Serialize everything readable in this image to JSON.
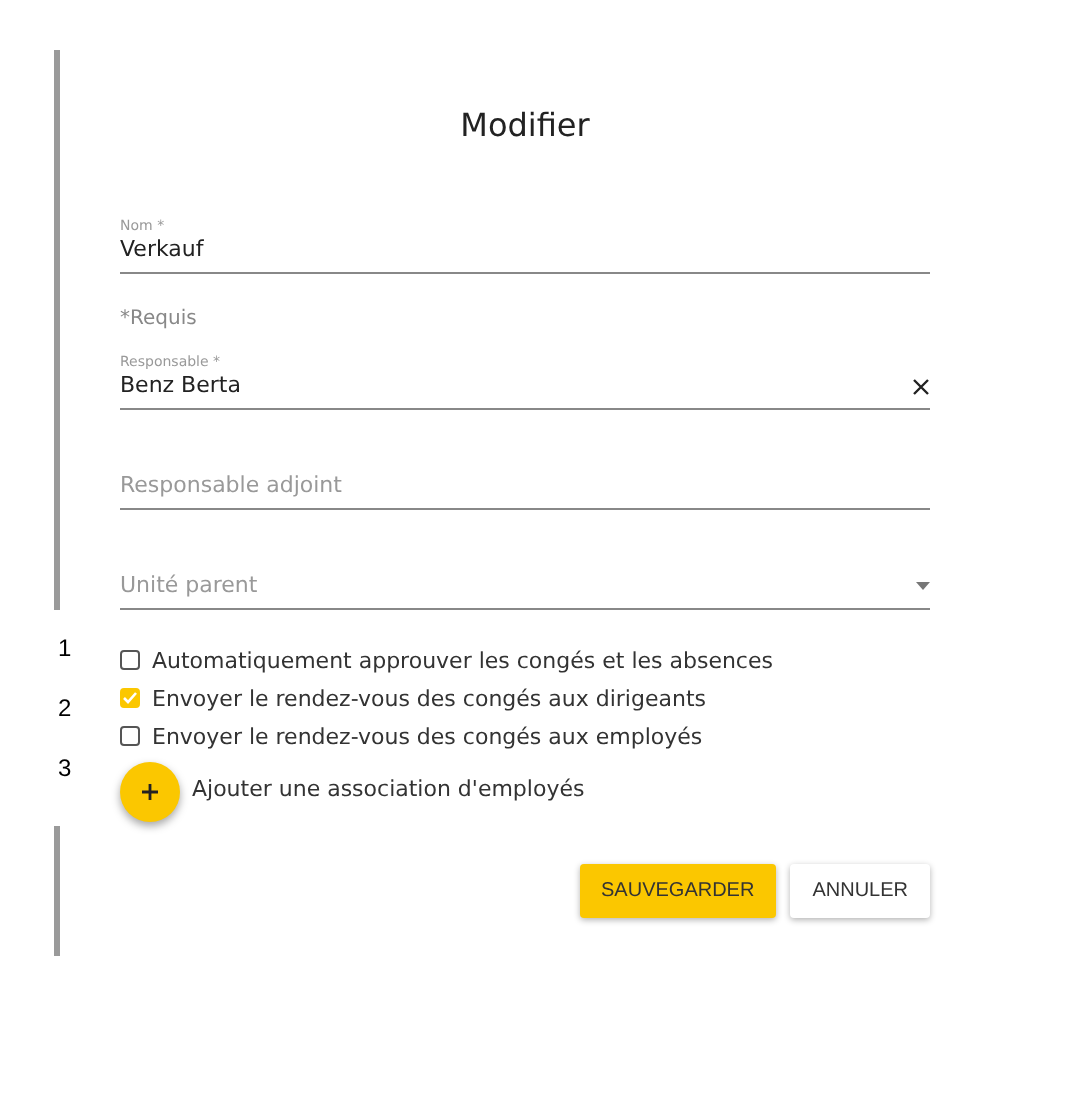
{
  "title": "Modifier",
  "fields": [
    {
      "kind": "text",
      "label": "Nom *",
      "value": "Verkauf"
    },
    {
      "kind": "clearable",
      "note": "*Requis",
      "label": "Responsable *",
      "value": "Benz Berta"
    },
    {
      "kind": "text",
      "placeholder": "Responsable adjoint"
    },
    {
      "kind": "select",
      "placeholder": "Unité parent"
    }
  ],
  "row_numbers": [
    "1",
    "2",
    "3"
  ],
  "checkboxes": [
    {
      "label": "Automatiquement approuver les congés et les absences",
      "checked": false
    },
    {
      "label": "Envoyer le rendez-vous des congés aux dirigeants",
      "checked": true
    },
    {
      "label": "Envoyer le rendez-vous des congés aux employés",
      "checked": false
    }
  ],
  "add_action": {
    "label": "Ajouter une association d'employés"
  },
  "buttons": [
    {
      "label": "SAUVEGARDER",
      "kind": "primary"
    },
    {
      "label": "ANNULER",
      "kind": "secondary"
    }
  ]
}
